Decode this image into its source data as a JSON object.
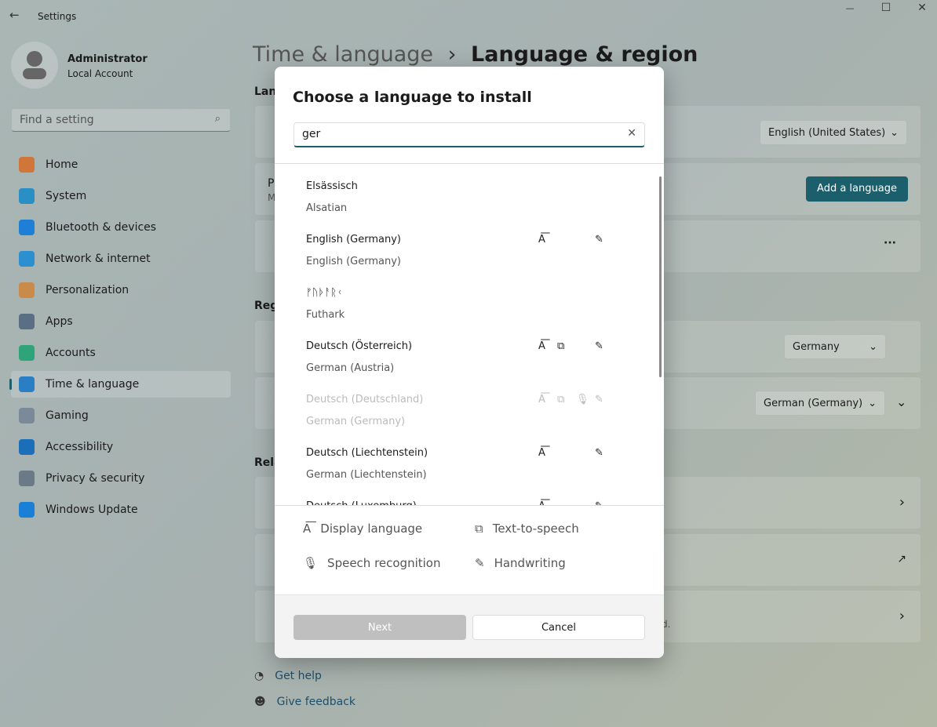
{
  "window": {
    "title": "Settings",
    "minimize": "—",
    "maximize": "☐",
    "close": "✕",
    "back": "←"
  },
  "user": {
    "name": "Administrator",
    "account": "Local Account"
  },
  "search": {
    "placeholder": "Find a setting"
  },
  "sidebar": {
    "items": [
      {
        "label": "Home",
        "color": "#d0763a"
      },
      {
        "label": "System",
        "color": "#2a8fc4"
      },
      {
        "label": "Bluetooth & devices",
        "color": "#1f7fd6"
      },
      {
        "label": "Network & internet",
        "color": "#2b8fd0"
      },
      {
        "label": "Personalization",
        "color": "#c98a4a"
      },
      {
        "label": "Apps",
        "color": "#5a6f86"
      },
      {
        "label": "Accounts",
        "color": "#2fa37a"
      },
      {
        "label": "Time & language",
        "color": "#2a7fc4",
        "active": true
      },
      {
        "label": "Gaming",
        "color": "#7a8a99"
      },
      {
        "label": "Accessibility",
        "color": "#1a6fb8"
      },
      {
        "label": "Privacy & security",
        "color": "#6c7a88"
      },
      {
        "label": "Windows Update",
        "color": "#1a7fd6"
      }
    ]
  },
  "breadcrumb": {
    "parent": "Time & language",
    "sep": "›",
    "current": "Language & region"
  },
  "main": {
    "sections": {
      "language": "Lang",
      "region": "Regi",
      "related": "Rela"
    },
    "display_language": "English (United States)",
    "add_language": "Add a language",
    "more": "···",
    "card_p": "P",
    "card_m": "M",
    "country": "Germany",
    "regional_format": "German (Germany)",
    "tail_text": "d.",
    "links": {
      "help": "Get help",
      "feedback": "Give feedback"
    }
  },
  "dialog": {
    "title": "Choose a language to install",
    "search_value": "ger",
    "clear": "✕",
    "languages": [
      {
        "native": "Elsässisch",
        "english": "Alsatian",
        "features": []
      },
      {
        "native": "English (Germany)",
        "english": "English (Germany)",
        "features": [
          "display",
          "handwriting"
        ]
      },
      {
        "native": "ᚠᚢᚦᚨᚱᚲ",
        "english": "Futhark",
        "features": []
      },
      {
        "native": "Deutsch (Österreich)",
        "english": "German (Austria)",
        "features": [
          "display",
          "tts",
          "handwriting"
        ]
      },
      {
        "native": "Deutsch (Deutschland)",
        "english": "German (Germany)",
        "features": [
          "display",
          "tts",
          "speech",
          "handwriting"
        ],
        "disabled": true
      },
      {
        "native": "Deutsch (Liechtenstein)",
        "english": "German (Liechtenstein)",
        "features": [
          "display",
          "handwriting"
        ]
      },
      {
        "native": "Deutsch (Luxemburg)",
        "english": "",
        "features": [
          "display",
          "handwriting"
        ]
      }
    ],
    "legend": {
      "display": "Display language",
      "tts": "Text-to-speech",
      "speech": "Speech recognition",
      "handwriting": "Handwriting"
    },
    "next": "Next",
    "cancel": "Cancel"
  }
}
